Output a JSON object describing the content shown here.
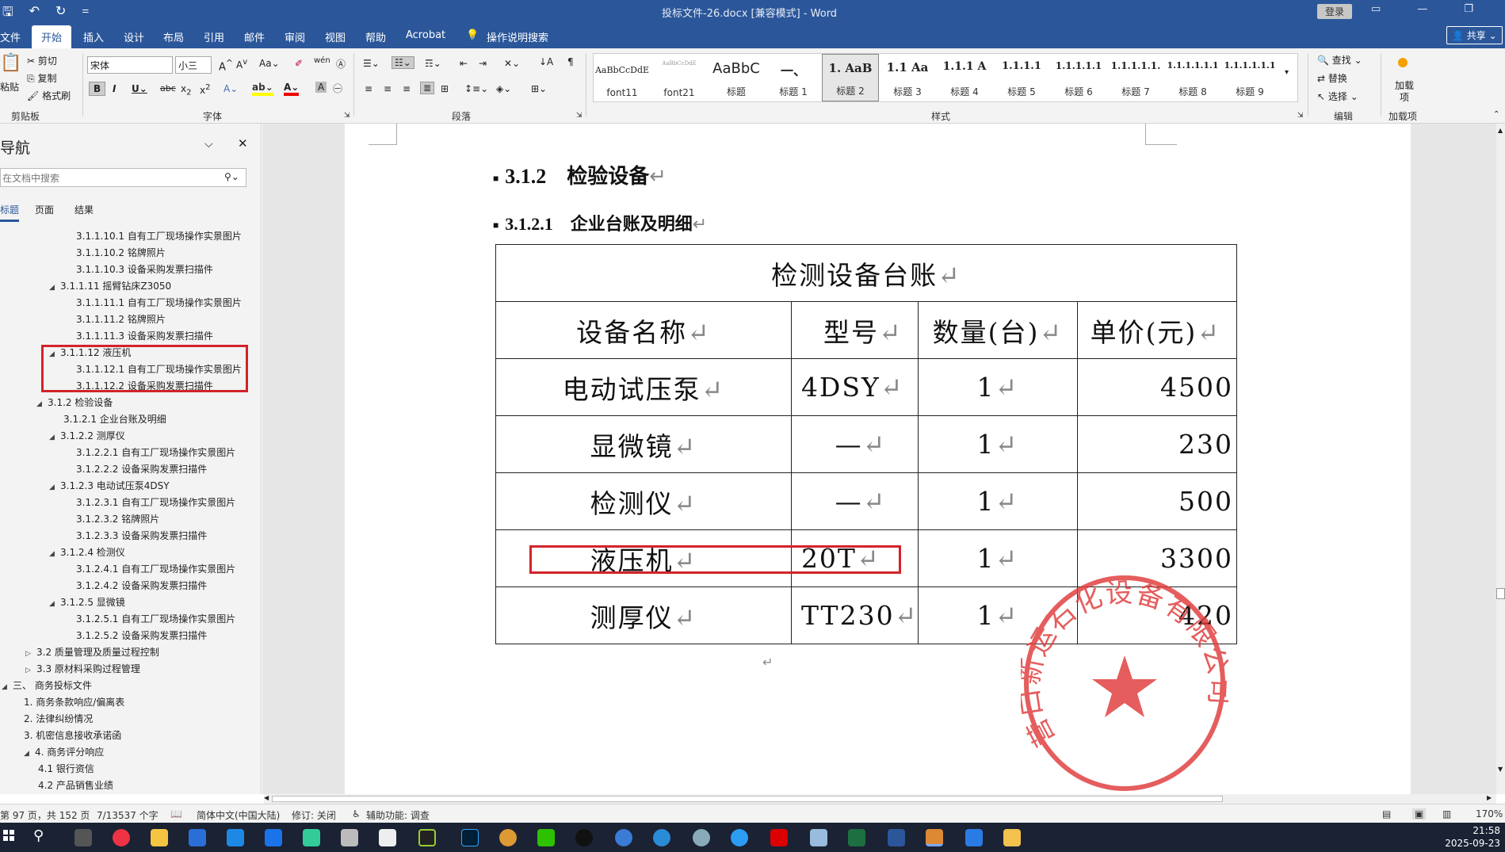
{
  "window": {
    "title": "投标文件-26.docx [兼容模式] - Word",
    "login": "登录",
    "share": "共享"
  },
  "tabs": [
    "文件",
    "开始",
    "插入",
    "设计",
    "布局",
    "引用",
    "邮件",
    "审阅",
    "视图",
    "帮助",
    "Acrobat",
    "操作说明搜索"
  ],
  "ribbon": {
    "clipboard": {
      "paste": "粘贴",
      "cut": "剪切",
      "copy": "复制",
      "format_painter": "格式刷",
      "label": "剪贴板"
    },
    "font": {
      "name": "宋体",
      "size": "小三",
      "label": "字体"
    },
    "paragraph": {
      "label": "段落"
    },
    "styles": {
      "label": "样式",
      "items": [
        {
          "preview": "AaBbCcDdE",
          "name": "font11"
        },
        {
          "preview": "AaBbCcDdE",
          "name": "font21"
        },
        {
          "preview": "AaBbC",
          "name": "标题"
        },
        {
          "preview": "一、",
          "name": "标题 1"
        },
        {
          "preview": "1. AaB",
          "name": "标题 2"
        },
        {
          "preview": "1.1 Aa",
          "name": "标题 3"
        },
        {
          "preview": "1.1.1 A",
          "name": "标题 4"
        },
        {
          "preview": "1.1.1.1",
          "name": "标题 5"
        },
        {
          "preview": "1.1.1.1.1",
          "name": "标题 6"
        },
        {
          "preview": "1.1.1.1.1.",
          "name": "标题 7"
        },
        {
          "preview": "1.1.1.1.1.1",
          "name": "标题 8"
        },
        {
          "preview": "1.1.1.1.1.1",
          "name": "标题 9"
        }
      ]
    },
    "editing": {
      "find": "查找",
      "replace": "替换",
      "select": "选择",
      "label": "编辑"
    },
    "addins": {
      "button": "加载项",
      "label": "加载项"
    }
  },
  "nav": {
    "title": "导航",
    "search_placeholder": "在文档中搜索",
    "tabs": [
      "标题",
      "页面",
      "结果"
    ],
    "items": [
      {
        "text": "3.1.1.10.1 自有工厂现场操作实景图片",
        "level": 5,
        "tri": ""
      },
      {
        "text": "3.1.1.10.2 铭牌照片",
        "level": 5,
        "tri": ""
      },
      {
        "text": "3.1.1.10.3 设备采购发票扫描件",
        "level": 5,
        "tri": ""
      },
      {
        "text": "3.1.1.11 摇臂钻床Z3050",
        "level": 4,
        "tri": "◢"
      },
      {
        "text": "3.1.1.11.1 自有工厂现场操作实景图片",
        "level": 5,
        "tri": ""
      },
      {
        "text": "3.1.1.11.2 铭牌照片",
        "level": 5,
        "tri": ""
      },
      {
        "text": "3.1.1.11.3 设备采购发票扫描件",
        "level": 5,
        "tri": ""
      },
      {
        "text": "3.1.1.12 液压机",
        "level": 4,
        "tri": "◢"
      },
      {
        "text": "3.1.1.12.1 自有工厂现场操作实景图片",
        "level": 5,
        "tri": ""
      },
      {
        "text": "3.1.1.12.2 设备采购发票扫描件",
        "level": 5,
        "tri": ""
      },
      {
        "text": "3.1.2 检验设备",
        "level": 3,
        "tri": "◢"
      },
      {
        "text": "3.1.2.1 企业台账及明细",
        "level": 4,
        "tri": ""
      },
      {
        "text": "3.1.2.2 测厚仪",
        "level": 4,
        "tri": "◢"
      },
      {
        "text": "3.1.2.2.1 自有工厂现场操作实景图片",
        "level": 5,
        "tri": ""
      },
      {
        "text": "3.1.2.2.2 设备采购发票扫描件",
        "level": 5,
        "tri": ""
      },
      {
        "text": "3.1.2.3 电动试压泵4DSY",
        "level": 4,
        "tri": "◢"
      },
      {
        "text": "3.1.2.3.1 自有工厂现场操作实景图片",
        "level": 5,
        "tri": ""
      },
      {
        "text": "3.1.2.3.2 铭牌照片",
        "level": 5,
        "tri": ""
      },
      {
        "text": "3.1.2.3.3 设备采购发票扫描件",
        "level": 5,
        "tri": ""
      },
      {
        "text": "3.1.2.4 检测仪",
        "level": 4,
        "tri": "◢"
      },
      {
        "text": "3.1.2.4.1 自有工厂现场操作实景图片",
        "level": 5,
        "tri": ""
      },
      {
        "text": "3.1.2.4.2 设备采购发票扫描件",
        "level": 5,
        "tri": ""
      },
      {
        "text": "3.1.2.5 显微镜",
        "level": 4,
        "tri": "◢"
      },
      {
        "text": "3.1.2.5.1 自有工厂现场操作实景图片",
        "level": 5,
        "tri": ""
      },
      {
        "text": "3.1.2.5.2 设备采购发票扫描件",
        "level": 5,
        "tri": ""
      },
      {
        "text": "3.2 质量管理及质量过程控制",
        "level": 2,
        "tri": "▷"
      },
      {
        "text": "3.3 原材料采购过程管理",
        "level": 2,
        "tri": "▷"
      },
      {
        "text": "三、 商务投标文件",
        "level": 0,
        "tri": "◢"
      },
      {
        "text": "1. 商务条款响应/偏离表",
        "level": 1,
        "tri": ""
      },
      {
        "text": "2. 法律纠纷情况",
        "level": 1,
        "tri": ""
      },
      {
        "text": "3. 机密信息接收承诺函",
        "level": 1,
        "tri": ""
      },
      {
        "text": "4. 商务评分响应",
        "level": 1,
        "tri": "◢"
      },
      {
        "text": "4.1 银行资信",
        "level": 2,
        "tri": ""
      },
      {
        "text": "4.2 产品销售业绩",
        "level": 2,
        "tri": ""
      }
    ]
  },
  "document": {
    "heading1": "3.1.2　检验设备",
    "heading2": "3.1.2.1　企业台账及明细",
    "table_title": "检测设备台账",
    "columns": [
      "设备名称",
      "型号",
      "数量(台)",
      "单价(元)"
    ],
    "rows": [
      [
        "电动试压泵",
        "4DSY",
        "1",
        "4500"
      ],
      [
        "显微镜",
        "—",
        "1",
        "230"
      ],
      [
        "检测仪",
        "—",
        "1",
        "500"
      ],
      [
        "液压机",
        "20T",
        "1",
        "3300"
      ],
      [
        "测厚仪",
        "TT230",
        "1",
        "420"
      ]
    ],
    "return_mark": "↵",
    "seal_text": "营口新运石化设备有限公司"
  },
  "status": {
    "page": "第 97 页，共 152 页",
    "words": "7/13537 个字",
    "language": "简体中文(中国大陆)",
    "track": "修订: 关闭",
    "accessibility": "辅助功能: 调查",
    "zoom": "170%"
  },
  "taskbar": {
    "time": "21:58",
    "date": "2025-09-23"
  }
}
